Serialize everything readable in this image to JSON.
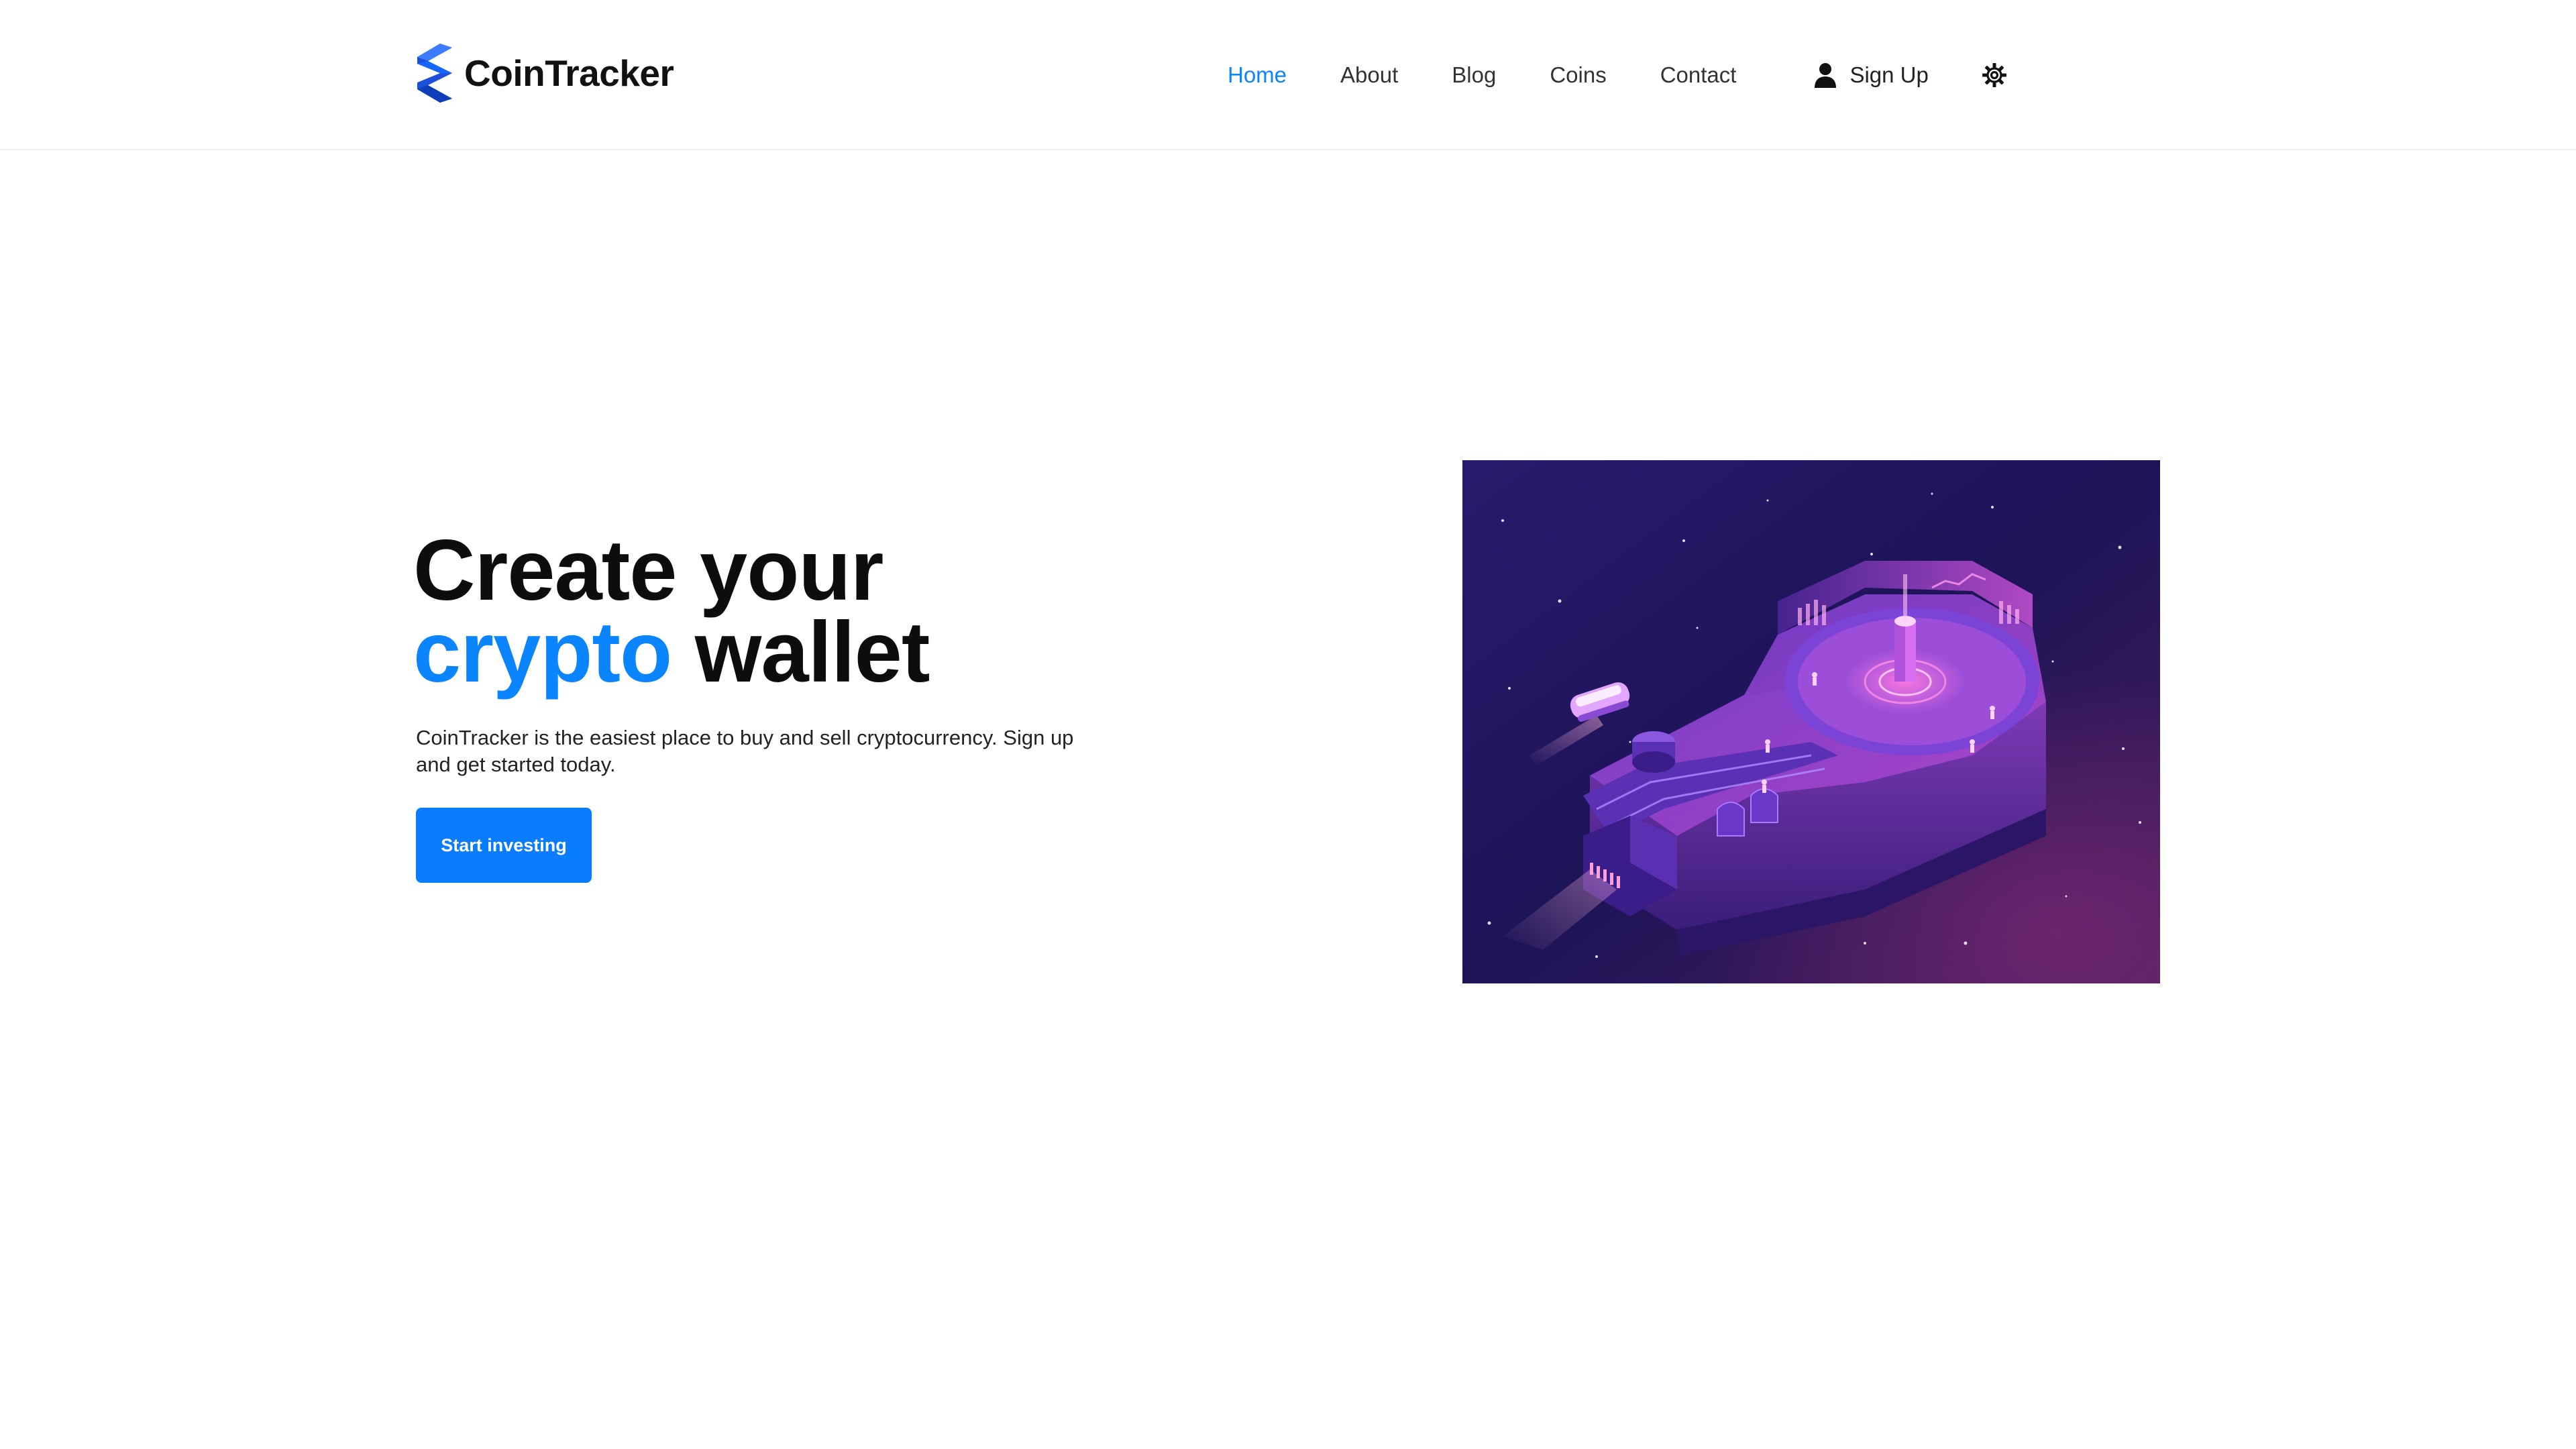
{
  "brand": {
    "name": "CoinTracker",
    "accent_color": "#0a84ff",
    "logo_icon": "stacked-chevron-logo"
  },
  "nav": {
    "items": [
      {
        "label": "Home",
        "active": true
      },
      {
        "label": "About",
        "active": false
      },
      {
        "label": "Blog",
        "active": false
      },
      {
        "label": "Coins",
        "active": false
      },
      {
        "label": "Contact",
        "active": false
      }
    ],
    "signup_label": "Sign Up",
    "signup_icon": "user-icon",
    "settings_icon": "gear-icon"
  },
  "hero": {
    "title_line1": "Create your",
    "title_accent": "crypto",
    "title_rest": " wallet",
    "description": "CoinTracker is the easiest place to buy and sell cryptocurrency. Sign up and get started today.",
    "cta_label": "Start investing",
    "cta_color": "#0a7cff",
    "illustration": "isometric-crypto-city-illustration"
  }
}
